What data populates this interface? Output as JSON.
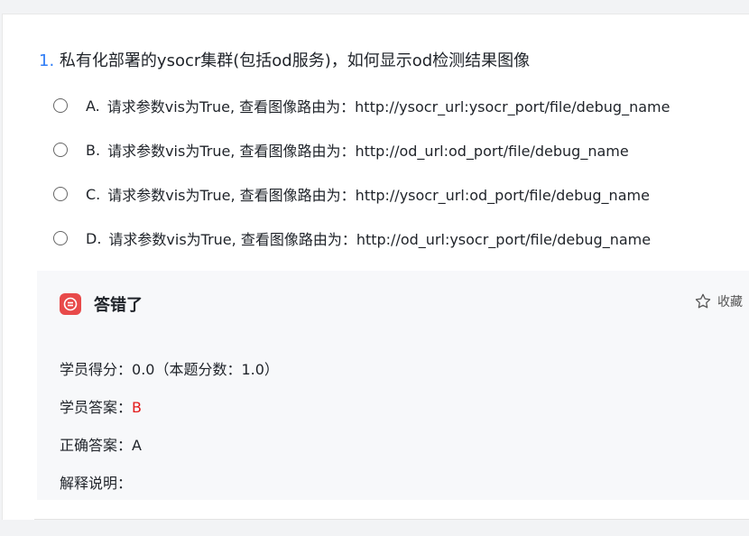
{
  "question": {
    "number": "1.",
    "text": "私有化部署的ysocr集群(包括od服务)，如何显示od检测结果图像"
  },
  "options": [
    {
      "letter": "A.",
      "text": "请求参数vis为True, 查看图像路由为：http://ysocr_url:ysocr_port/file/debug_name"
    },
    {
      "letter": "B.",
      "text": "请求参数vis为True, 查看图像路由为：http://od_url:od_port/file/debug_name"
    },
    {
      "letter": "C.",
      "text": "请求参数vis为True, 查看图像路由为：http://ysocr_url:od_port/file/debug_name"
    },
    {
      "letter": "D.",
      "text": "请求参数vis为True, 查看图像路由为：http://od_url:ysocr_port/file/debug_name"
    }
  ],
  "result": {
    "title": "答错了",
    "favorite_label": "收藏",
    "score_label": "学员得分：",
    "score_value": "0.0（本题分数：1.0）",
    "student_answer_label": "学员答案：",
    "student_answer_value": "B",
    "correct_answer_label": "正确答案：",
    "correct_answer_value": "A",
    "explanation_label": "解释说明："
  },
  "colors": {
    "accent": "#2f7df6",
    "wrong": "#e84a4a",
    "wrong_text": "#e31b1b"
  },
  "icons": {
    "wrong": "wrong-answer-icon",
    "favorite": "star-outline-icon"
  }
}
